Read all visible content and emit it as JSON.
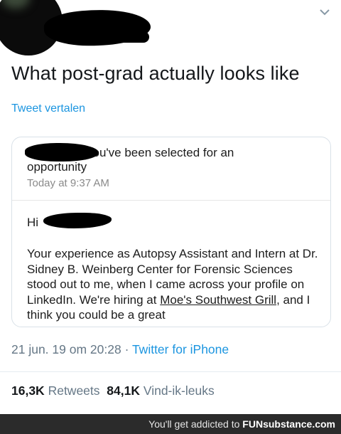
{
  "tweet": {
    "text": "What post-grad actually looks like",
    "translate_label": "Tweet vertalen",
    "date": "21 jun. 19 om 20:28",
    "separator": "·",
    "source": "Twitter for iPhone",
    "retweets_count": "16,3K",
    "retweets_label": "Retweets",
    "likes_count": "84,1K",
    "likes_label": "Vind-ik-leuks"
  },
  "card": {
    "subject_line1": "you've been selected for an",
    "subject_line2": "opportunity",
    "time": "Today at 9:37 AM",
    "greeting": "Hi",
    "body_pre": "Your experience as Autopsy Assistant and Intern at Dr. Sidney B. Weinberg Center for Forensic Sciences stood out to me, when I came across your profile on LinkedIn. We're hiring at ",
    "body_link": "Moe's Southwest Grill",
    "body_post": ", and I think you could be a great"
  },
  "footer": {
    "prefix": "You'll get addicted to ",
    "brand": "FUNsubstance.com"
  },
  "icons": {
    "menu": "chevron-down-icon"
  }
}
